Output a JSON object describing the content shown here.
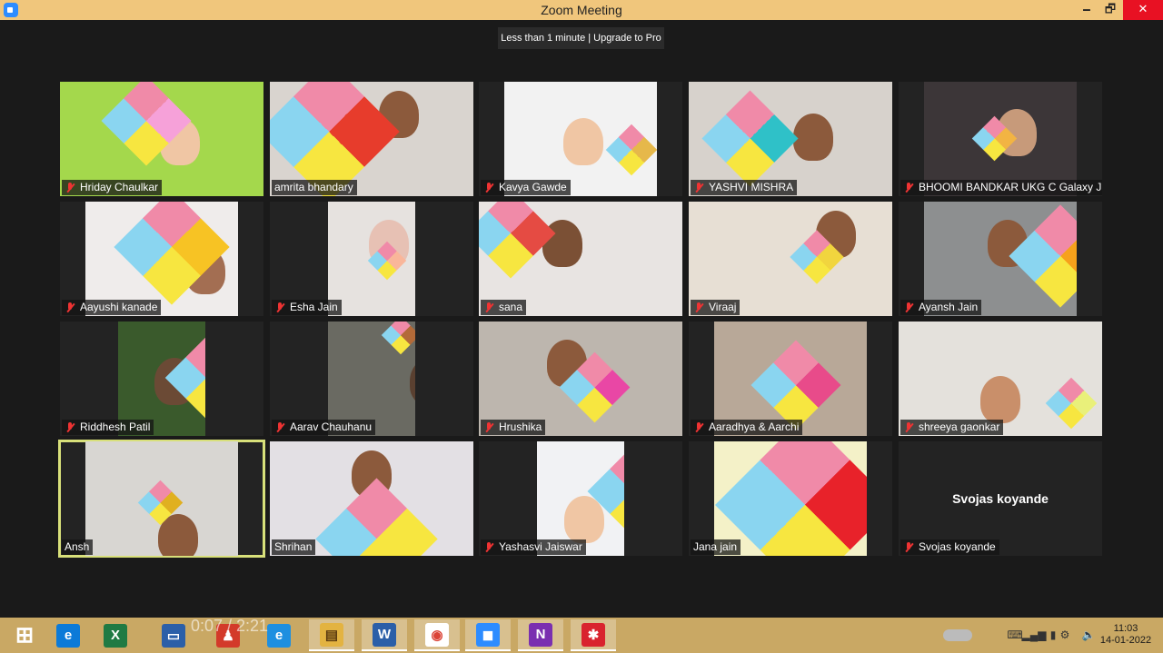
{
  "window": {
    "title": "Zoom Meeting",
    "minimize": "🗕",
    "maximize": "🗗",
    "close": "✕"
  },
  "banner": {
    "text": "Less than 1 minute | Upgrade to Pro"
  },
  "participants": [
    {
      "name": "Hriday Chaulkar",
      "muted": true
    },
    {
      "name": "amrita bhandary",
      "muted": false
    },
    {
      "name": "Kavya Gawde",
      "muted": true
    },
    {
      "name": "YASHVI MISHRA",
      "muted": true
    },
    {
      "name": "BHOOMI BANDKAR UKG C Galaxy J7",
      "muted": true
    },
    {
      "name": "Aayushi kanade",
      "muted": true
    },
    {
      "name": "Esha Jain",
      "muted": true
    },
    {
      "name": "sana",
      "muted": true
    },
    {
      "name": "Viraaj",
      "muted": true
    },
    {
      "name": "Ayansh Jain",
      "muted": true
    },
    {
      "name": "Riddhesh Patil",
      "muted": true
    },
    {
      "name": "Aarav Chauhanu",
      "muted": true
    },
    {
      "name": "Hrushika",
      "muted": true
    },
    {
      "name": "Aaradhya & Aarchi",
      "muted": true
    },
    {
      "name": "shreeya  gaonkar",
      "muted": true
    },
    {
      "name": "Ansh",
      "muted": false,
      "active_speaker": true
    },
    {
      "name": "Shrihan",
      "muted": false
    },
    {
      "name": "Yashasvi Jaiswar",
      "muted": true
    },
    {
      "name": "Jana jain",
      "muted": false
    },
    {
      "name": "Svojas koyande",
      "muted": true,
      "video_off": true,
      "display_name": "Svojas koyande"
    }
  ],
  "taskbar": {
    "items": [
      {
        "name": "start",
        "glyph": "⊞"
      },
      {
        "name": "edge",
        "glyph": "e"
      },
      {
        "name": "excel",
        "glyph": "X"
      },
      {
        "name": "lenovo",
        "glyph": "▭"
      },
      {
        "name": "red-app",
        "glyph": "♟"
      },
      {
        "name": "internet-explorer",
        "glyph": "e"
      },
      {
        "name": "file-explorer",
        "glyph": "▤"
      },
      {
        "name": "word",
        "glyph": "W"
      },
      {
        "name": "chrome",
        "glyph": "◉"
      },
      {
        "name": "zoom",
        "glyph": "◼"
      },
      {
        "name": "onenote",
        "glyph": "N"
      },
      {
        "name": "red-star-app",
        "glyph": "✱"
      }
    ],
    "overlay_time": "0:07 / 2:21",
    "clock_time": "11:03",
    "clock_date": "14-01-2022"
  },
  "colors": {
    "titlebar": "#f0c67c",
    "taskbar": "#c9a864",
    "active_border": "#d8e07a",
    "muted_red": "#e33333"
  }
}
